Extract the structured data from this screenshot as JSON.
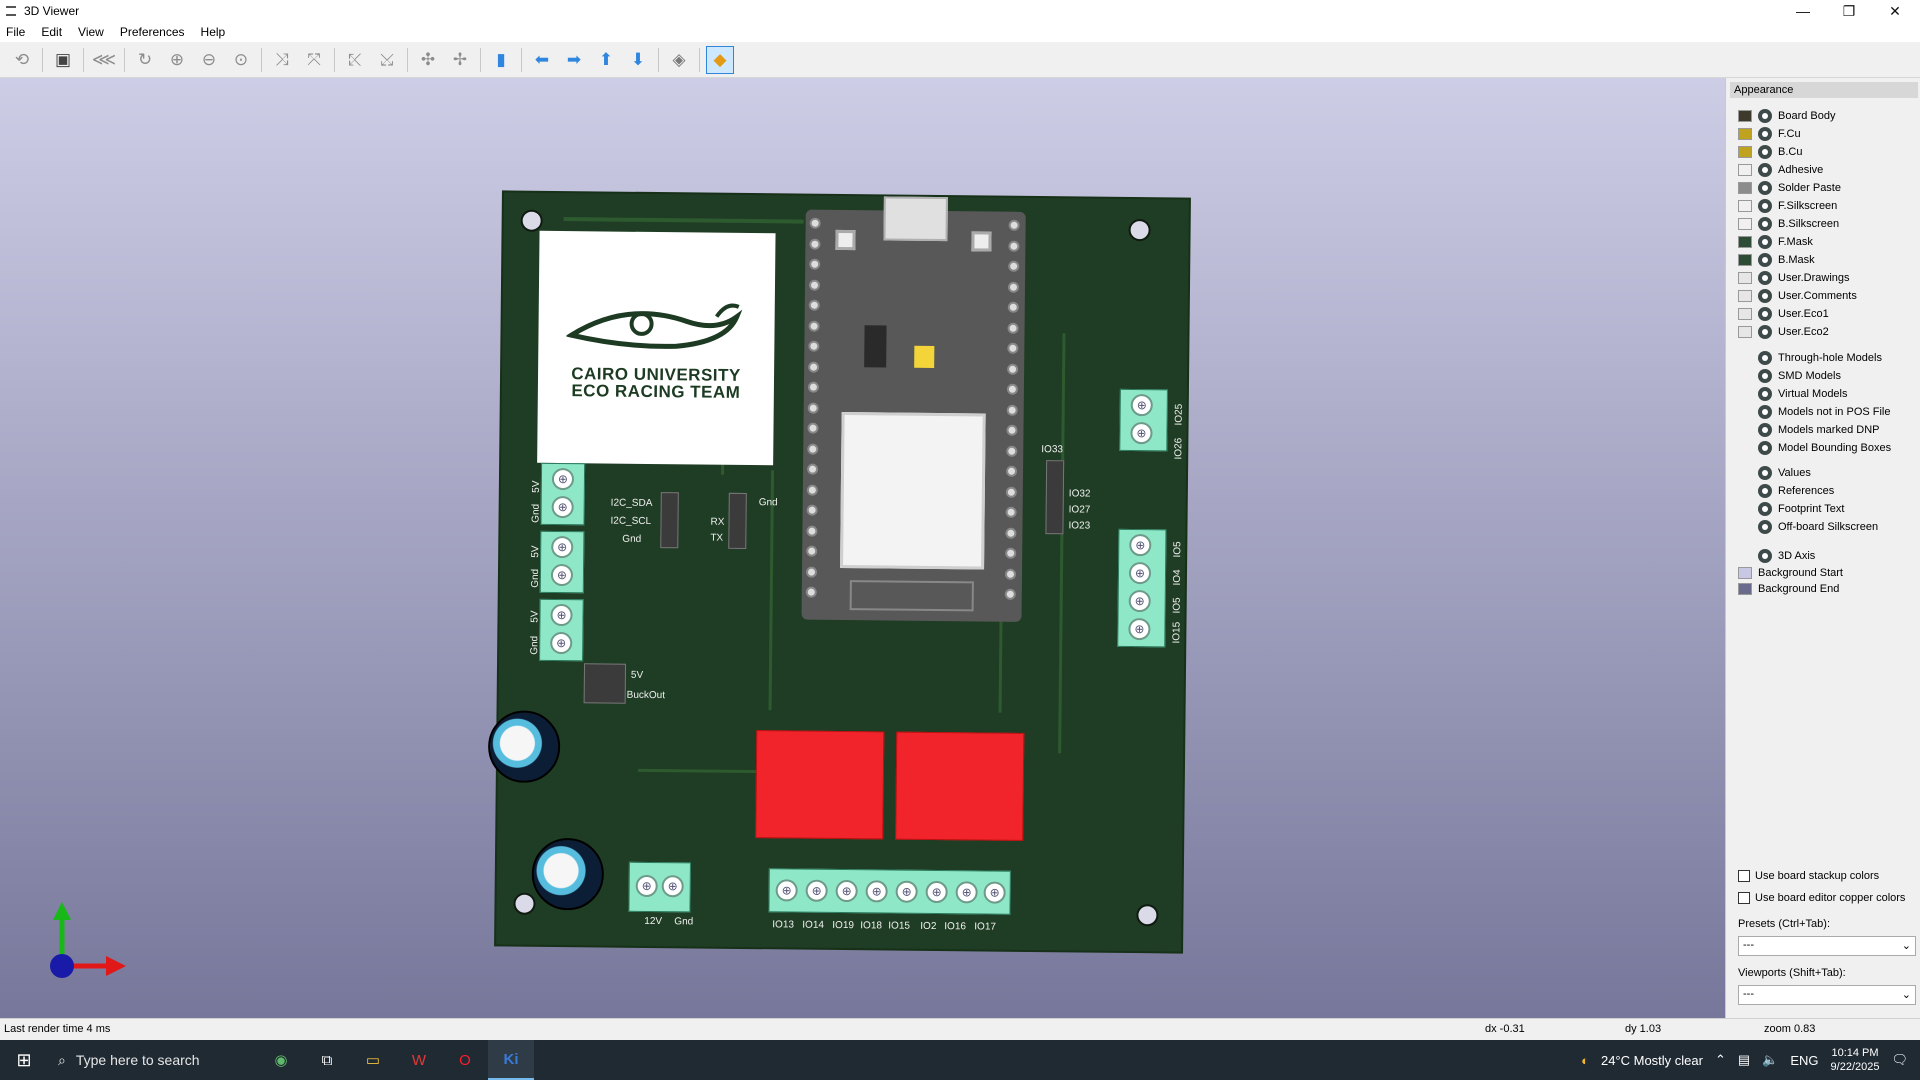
{
  "window": {
    "title": "3D Viewer",
    "controls": {
      "minimize": "—",
      "maximize": "❐",
      "close": "✕"
    }
  },
  "menu": [
    "File",
    "Edit",
    "View",
    "Preferences",
    "Help"
  ],
  "toolbar_icons": [
    "reload-icon",
    "copy-icon",
    "raytrace-icon",
    "redraw-icon",
    "zoom-in-icon",
    "zoom-out-icon",
    "zoom-fit-icon",
    "rotate-x-cw-icon",
    "rotate-x-ccw-icon",
    "rotate-y-cw-icon",
    "rotate-y-ccw-icon",
    "rotate-z-cw-icon",
    "rotate-z-ccw-icon",
    "flip-board-icon",
    "move-left-icon",
    "move-right-icon",
    "move-up-icon",
    "move-down-icon",
    "ortho-icon",
    "layers-panel-icon"
  ],
  "board": {
    "logo": {
      "line1": "CAIRO UNIVERSITY",
      "line2": "ECO RACING TEAM"
    },
    "labels": {
      "i2c_sda": "I2C_SDA",
      "i2c_scl": "I2C_SCL",
      "gnd": "Gnd",
      "rx": "RX",
      "tx": "TX",
      "gnd2": "Gnd",
      "v5": "5V",
      "buckout": "BuckOut",
      "io33": "IO33",
      "io32": "IO32",
      "io27": "IO27",
      "io23": "IO23",
      "io26": "IO26",
      "io25": "IO25",
      "v12": "12V",
      "gnd3": "Gnd",
      "vleft1": "5V",
      "gleft1": "Gnd",
      "vleft2": "5V",
      "gleft2": "Gnd",
      "vleft3": "5V",
      "gleft3": "Gnd",
      "io_right": [
        "IO5",
        "IO4",
        "IO5",
        "IO15"
      ]
    },
    "bottom_pins": [
      "IO13",
      "IO14",
      "IO19",
      "IO18",
      "IO15",
      "IO2",
      "IO16",
      "IO17"
    ]
  },
  "appearance": {
    "title": "Appearance",
    "layers": [
      {
        "name": "Board Body",
        "color": "#3d3a2c"
      },
      {
        "name": "F.Cu",
        "color": "#bfa21d"
      },
      {
        "name": "B.Cu",
        "color": "#bfa21d"
      },
      {
        "name": "Adhesive",
        "color": "#f0f0f0"
      },
      {
        "name": "Solder Paste",
        "color": "#8c8c8c"
      },
      {
        "name": "F.Silkscreen",
        "color": "#f0f0f0"
      },
      {
        "name": "B.Silkscreen",
        "color": "#f0f0f0"
      },
      {
        "name": "F.Mask",
        "color": "#2c4c36"
      },
      {
        "name": "B.Mask",
        "color": "#2c4c36"
      },
      {
        "name": "User.Drawings",
        "color": "#e6e6e6"
      },
      {
        "name": "User.Comments",
        "color": "#e6e6e6"
      },
      {
        "name": "User.Eco1",
        "color": "#e6e6e6"
      },
      {
        "name": "User.Eco2",
        "color": "#e6e6e6"
      }
    ],
    "models": [
      "Through-hole Models",
      "SMD Models",
      "Virtual Models",
      "Models not in POS File",
      "Models marked DNP",
      "Model Bounding Boxes"
    ],
    "other": [
      "Values",
      "References",
      "Footprint Text",
      "Off-board Silkscreen"
    ],
    "misc": {
      "axis": "3D Axis",
      "bg_start": "Background Start",
      "bg_end": "Background End",
      "bg_start_color": "#c8c8e4",
      "bg_end_color": "#6a6a8c"
    },
    "stackup": "Use board stackup colors",
    "copper": "Use board editor copper colors",
    "presets_label": "Presets (Ctrl+Tab):",
    "presets_value": "---",
    "viewports_label": "Viewports (Shift+Tab):",
    "viewports_value": "---"
  },
  "status": {
    "render": "Last render time 4 ms",
    "dx": "dx -0.31",
    "dy": "dy 1.03",
    "zoom": "zoom 0.83"
  },
  "taskbar": {
    "search": "Type here to search",
    "weather": "24°C  Mostly clear",
    "lang": "ENG",
    "time": "10:14 PM",
    "date": "9/22/2025"
  }
}
